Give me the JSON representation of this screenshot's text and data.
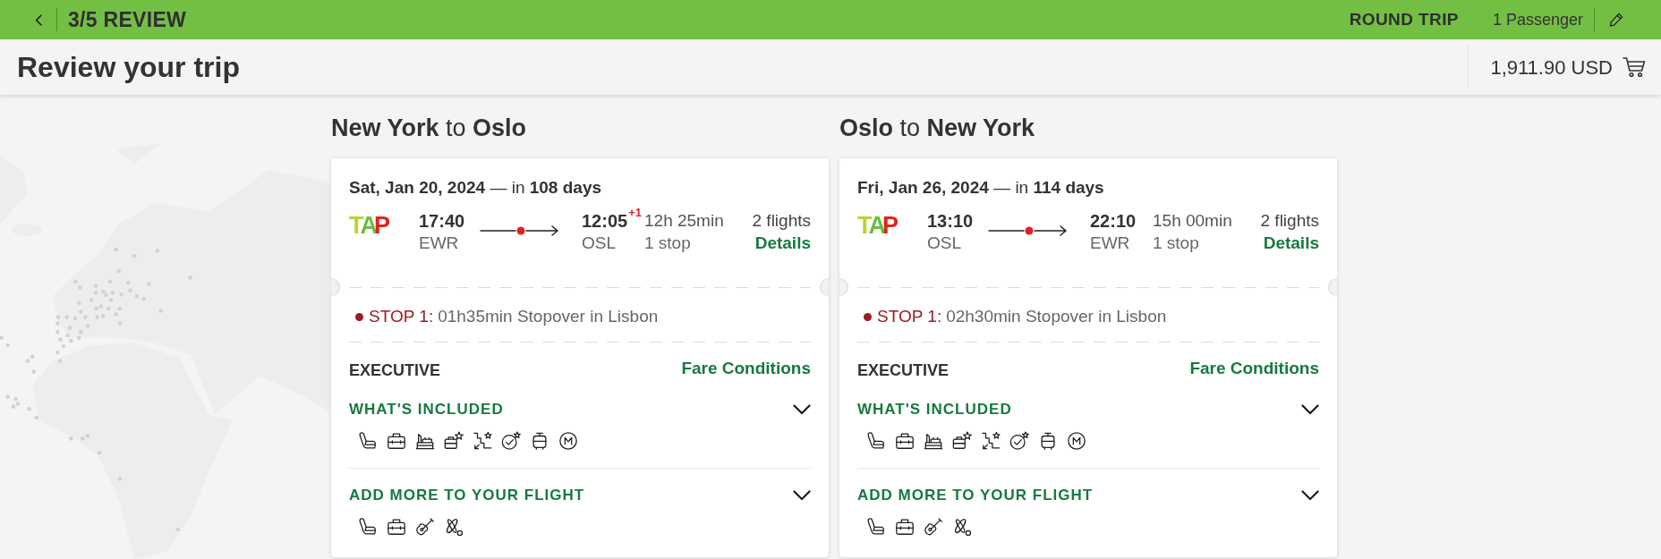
{
  "top_bar": {
    "step": "3/5 REVIEW",
    "trip_type": "ROUND TRIP",
    "passengers": "1 Passenger"
  },
  "summary_bar": {
    "title": "Review your trip",
    "total": "1,911.90 USD"
  },
  "legs": [
    {
      "heading": "**New York** to **Oslo**",
      "date_line": "**Sat, Jan 20, 2024** — in **108 days**",
      "airline_logo": "TAP",
      "departure": {
        "time": "17:40",
        "airport": "EWR"
      },
      "arrival": {
        "time": "12:05",
        "day_offset": "+1",
        "airport": "OSL"
      },
      "duration": "12h 25min",
      "stops": "1 stop",
      "flights": "2 flights",
      "details_link": "Details",
      "stopovers": [
        {
          "label": "STOP 1:",
          "text": "01h35min Stopover in Lisbon"
        }
      ],
      "cabin": "EXECUTIVE",
      "fare_link": "Fare Conditions",
      "sections": [
        {
          "kind": "included",
          "title": "WHAT'S INCLUDED",
          "expanded": false
        },
        {
          "kind": "extras",
          "title": "ADD MORE TO YOUR FLIGHT",
          "expanded": false
        }
      ]
    },
    {
      "heading": "**Oslo** to **New York**",
      "date_line": "**Fri, Jan 26, 2024** — in **114 days**",
      "airline_logo": "TAP",
      "departure": {
        "time": "13:10",
        "airport": "OSL"
      },
      "arrival": {
        "time": "22:10",
        "airport": "EWR"
      },
      "duration": "15h 00min",
      "stops": "1 stop",
      "flights": "2 flights",
      "details_link": "Details",
      "stopovers": [
        {
          "label": "STOP 1:",
          "text": "02h30min Stopover in Lisbon"
        }
      ],
      "cabin": "EXECUTIVE",
      "fare_link": "Fare Conditions",
      "sections": [
        {
          "kind": "included",
          "title": "WHAT'S INCLUDED",
          "expanded": false
        },
        {
          "kind": "extras",
          "title": "ADD MORE TO YOUR FLIGHT",
          "expanded": false
        }
      ]
    }
  ]
}
